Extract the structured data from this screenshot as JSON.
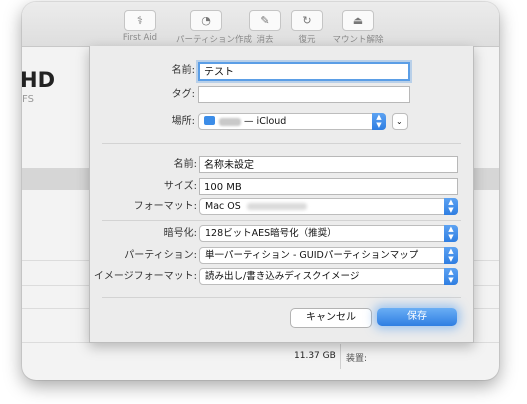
{
  "toolbar": {
    "items": [
      {
        "label": "First Aid",
        "icon": "stethoscope-icon",
        "glyph": "⚕"
      },
      {
        "label": "パーティション作成",
        "icon": "pie-chart-icon",
        "glyph": "◔"
      },
      {
        "label": "消去",
        "icon": "erase-icon",
        "glyph": "✎"
      },
      {
        "label": "復元",
        "icon": "restore-icon",
        "glyph": "↻"
      },
      {
        "label": "マウント解除",
        "icon": "eject-icon",
        "glyph": "⏏"
      }
    ]
  },
  "background": {
    "disk_title": "HD",
    "disk_subtitle": "FS",
    "size_value": "11.37 GB",
    "device_label": "装置:"
  },
  "dialog": {
    "name_label": "名前:",
    "name_value": "テスト",
    "tag_label": "タグ:",
    "tag_value": "",
    "location_label": "場所:",
    "location_value": "— iCloud",
    "image_name_label": "名前:",
    "image_name_value": "名称未設定",
    "size_label": "サイズ:",
    "size_value": "100 MB",
    "format_label": "フォーマット:",
    "format_value": "Mac OS",
    "encryption_label": "暗号化:",
    "encryption_value": "128ビットAES暗号化（推奨）",
    "partition_label": "パーティション:",
    "partition_value": "単一パーティション - GUIDパーティションマップ",
    "image_format_label": "イメージフォーマット:",
    "image_format_value": "読み出し/書き込みディスクイメージ",
    "cancel_label": "キャンセル",
    "save_label": "保存"
  },
  "colors": {
    "accent": "#2f7ee2",
    "focus_ring": "#5b9ee6"
  }
}
